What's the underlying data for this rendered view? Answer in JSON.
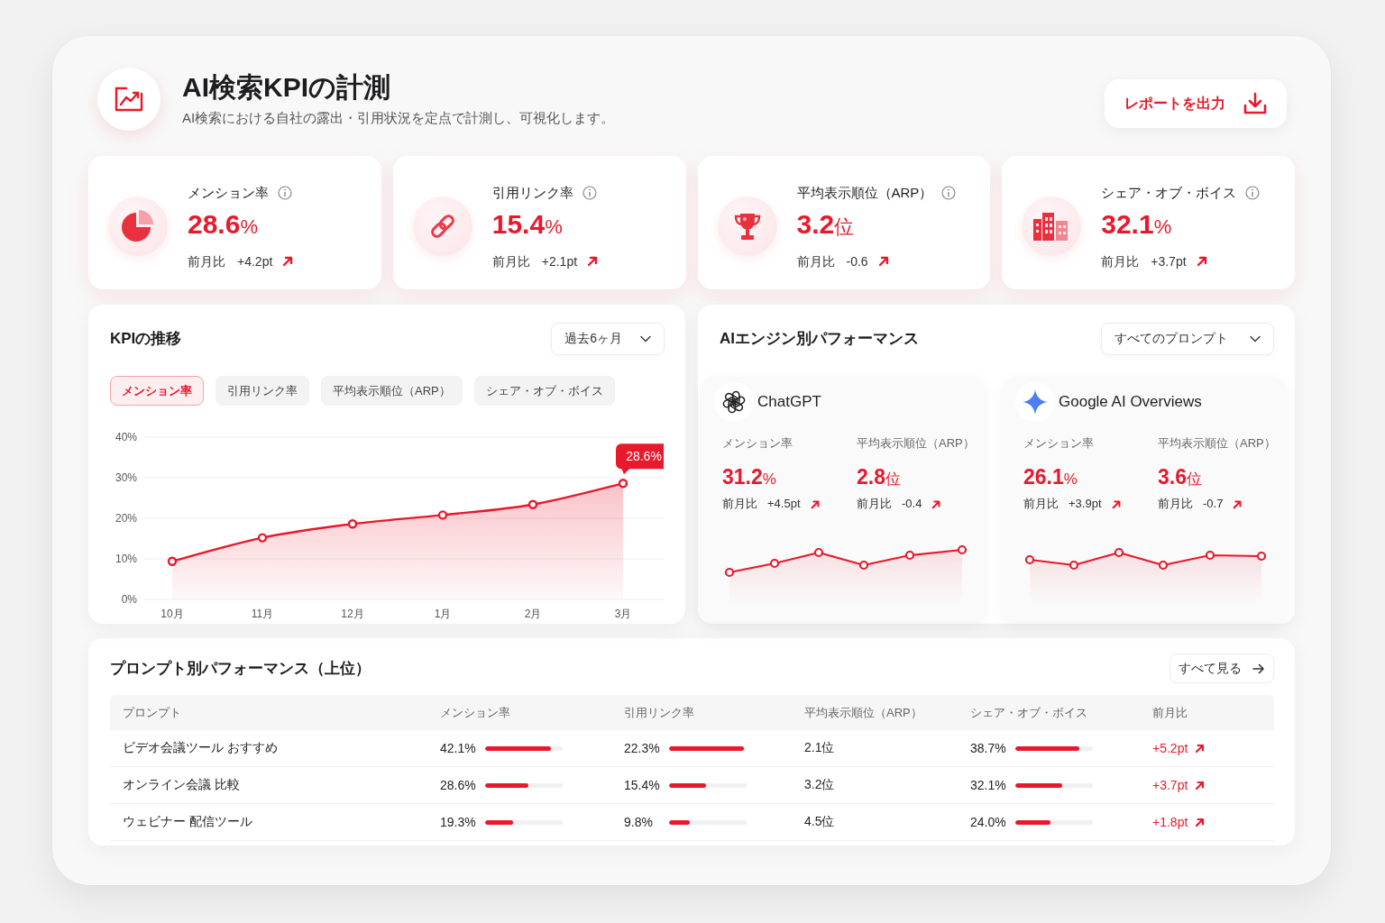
{
  "header": {
    "title": "AI検索KPIの計測",
    "subtitle": "AI検索における自社の露出・引用状況を定点で計測し、可視化します。",
    "export_button": "レポートを出力"
  },
  "kpi_cards": [
    {
      "label": "メンション率",
      "value": "28.6",
      "unit": "%",
      "change_label": "前月比",
      "change": "+4.2pt"
    },
    {
      "label": "引用リンク率",
      "value": "15.4",
      "unit": "%",
      "change_label": "前月比",
      "change": "+2.1pt"
    },
    {
      "label": "平均表示順位（ARP）",
      "value": "3.2",
      "unit": "位",
      "change_label": "前月比",
      "change": "-0.6"
    },
    {
      "label": "シェア・オブ・ボイス",
      "value": "32.1",
      "unit": "%",
      "change_label": "前月比",
      "change": "+3.7pt"
    }
  ],
  "kpi_trend": {
    "title": "KPIの推移",
    "period_select": "過去6ヶ月",
    "tabs": [
      {
        "label": "メンション率",
        "selected": true
      },
      {
        "label": "引用リンク率",
        "selected": false
      },
      {
        "label": "平均表示順位（ARP）",
        "selected": false
      },
      {
        "label": "シェア・オブ・ボイス",
        "selected": false
      }
    ],
    "chart_data": {
      "type": "area",
      "categories": [
        "10月",
        "11月",
        "12月",
        "1月",
        "2月",
        "3月"
      ],
      "series": [
        {
          "color": "#e8192c",
          "values": [
            9.4,
            15.2,
            18.6,
            20.8,
            23.4,
            28.6
          ]
        }
      ],
      "ylim": [
        0,
        40
      ],
      "yticks": [
        {
          "value": 0,
          "label": "0%"
        },
        {
          "value": 10,
          "label": "10%"
        },
        {
          "value": 20,
          "label": "20%"
        },
        {
          "value": 30,
          "label": "30%"
        },
        {
          "value": 40,
          "label": "40%"
        }
      ],
      "grid": true,
      "annotations": [
        "28.6%"
      ]
    }
  },
  "engine_performance": {
    "title": "AIエンジン別パフォーマンス",
    "prompt_select": "すべてのプロンプト",
    "engines": [
      {
        "name": "ChatGPT",
        "metrics": [
          {
            "label": "メンション率",
            "value": "31.2",
            "unit": "%",
            "change_label": "前月比",
            "change": "+4.5pt"
          },
          {
            "label": "平均表示順位（ARP）",
            "value": "2.8",
            "unit": "位",
            "change_label": "前月比",
            "change": "-0.4"
          }
        ]
      },
      {
        "name": "Google AI Overviews",
        "metrics": [
          {
            "label": "メンション率",
            "value": "26.1",
            "unit": "%",
            "change_label": "前月比",
            "change": "+3.9pt"
          },
          {
            "label": "平均表示順位（ARP）",
            "value": "3.6",
            "unit": "位",
            "change_label": "前月比",
            "change": "-0.7"
          }
        ]
      }
    ]
  },
  "prompt_table": {
    "title": "プロンプト別パフォーマンス（上位）",
    "view_all_button": "すべて見る",
    "columns": [
      "プロンプト",
      "メンション率",
      "引用リンク率",
      "平均表示順位（ARP）",
      "シェア・オブ・ボイス",
      "前月比"
    ],
    "rows": [
      {
        "prompt": "ビデオ会議ツール おすすめ",
        "mention": {
          "text": "42.1%",
          "level": 0.85
        },
        "citation": {
          "text": "22.3%",
          "level": 0.96
        },
        "arp": "2.1位",
        "share": {
          "text": "38.7%",
          "level": 0.82
        },
        "change": "+5.2pt"
      },
      {
        "prompt": "オンライン会議 比較",
        "mention": {
          "text": "28.6%",
          "level": 0.56
        },
        "citation": {
          "text": "15.4%",
          "level": 0.48
        },
        "arp": "3.2位",
        "share": {
          "text": "32.1%",
          "level": 0.6
        },
        "change": "+3.7pt"
      },
      {
        "prompt": "ウェビナー 配信ツール",
        "mention": {
          "text": "19.3%",
          "level": 0.36
        },
        "citation": {
          "text": "9.8%",
          "level": 0.27
        },
        "arp": "4.5位",
        "share": {
          "text": "24.0%",
          "level": 0.45
        },
        "change": "+1.8pt"
      }
    ]
  }
}
